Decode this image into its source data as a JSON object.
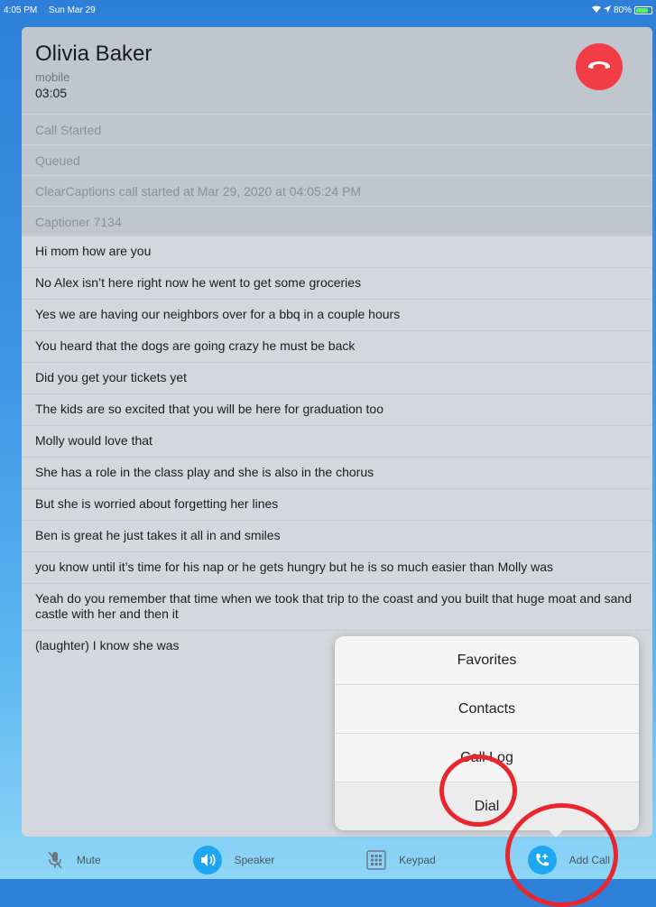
{
  "status_bar": {
    "time": "4:05 PM",
    "date": "Sun Mar 29",
    "battery": "80%",
    "battery_level": 0.8
  },
  "call": {
    "name": "Olivia Baker",
    "type": "mobile",
    "timer": "03:05"
  },
  "status_lines": [
    "Call Started",
    "Queued",
    "ClearCaptions call started at Mar 29, 2020 at 04:05:24 PM",
    "Captioner 7134"
  ],
  "captions": [
    "Hi mom how are you",
    "No Alex isn’t here right now he went to get some groceries",
    "Yes we are having our neighbors over for a bbq in a couple hours",
    "You heard that the dogs are going crazy he must be back",
    "Did you get your tickets yet",
    "The kids are so excited that you will be here for graduation too",
    "Molly would love that",
    "She has a role in the class play and she is also in the chorus",
    "But she is worried about forgetting her lines",
    "Ben is great he just takes it all in and smiles",
    "you know until it’s time for his nap or he gets hungry but he is so much easier than Molly was",
    "Yeah do you remember that time when we took that trip to the coast and you built that huge moat and sand castle with her and then it",
    "(laughter) I know she was"
  ],
  "popup_menu": {
    "items": [
      "Favorites",
      "Contacts",
      "Call Log",
      "Dial"
    ]
  },
  "tab_bar": {
    "mute": "Mute",
    "speaker": "Speaker",
    "keypad": "Keypad",
    "add_call": "Add Call"
  },
  "icons": {
    "hangup": "phone-hangup-icon",
    "mute": "microphone-off-icon",
    "speaker": "speaker-icon",
    "keypad": "keypad-icon",
    "add_call": "phone-add-icon"
  },
  "colors": {
    "accent": "#1ea6f0",
    "hangup": "#f23d47",
    "annotation": "#e9262e"
  }
}
